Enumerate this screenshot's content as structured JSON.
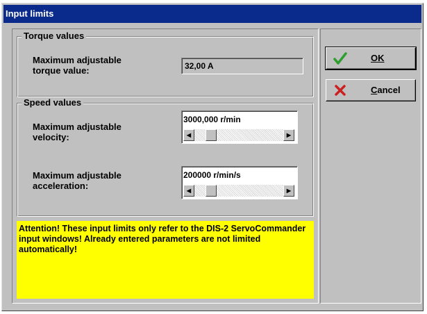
{
  "window": {
    "title": "Input limits"
  },
  "torque_group": {
    "legend": "Torque values",
    "label": "Maximum adjustable torque value:",
    "value": "32,00 A"
  },
  "speed_group": {
    "legend": "Speed values",
    "velocity": {
      "label": "Maximum adjustable velocity:",
      "value": "3000,000 r/min"
    },
    "acceleration": {
      "label": "Maximum adjustable acceleration:",
      "value": "200000 r/min/s"
    }
  },
  "warning": {
    "text": "Attention! These input limits only refer to the DIS-2 ServoCommander input windows! Already entered parameters are not limited automatically!",
    "background_color": "#ffff00"
  },
  "buttons": {
    "ok": {
      "label": "OK",
      "icon": "checkmark-icon",
      "color": "#2e9e2e"
    },
    "cancel": {
      "label": "Cancel",
      "icon": "cross-icon",
      "color": "#cc2020"
    }
  },
  "colors": {
    "title_bar": "#0a2a8c",
    "face": "#c0c0c0"
  }
}
